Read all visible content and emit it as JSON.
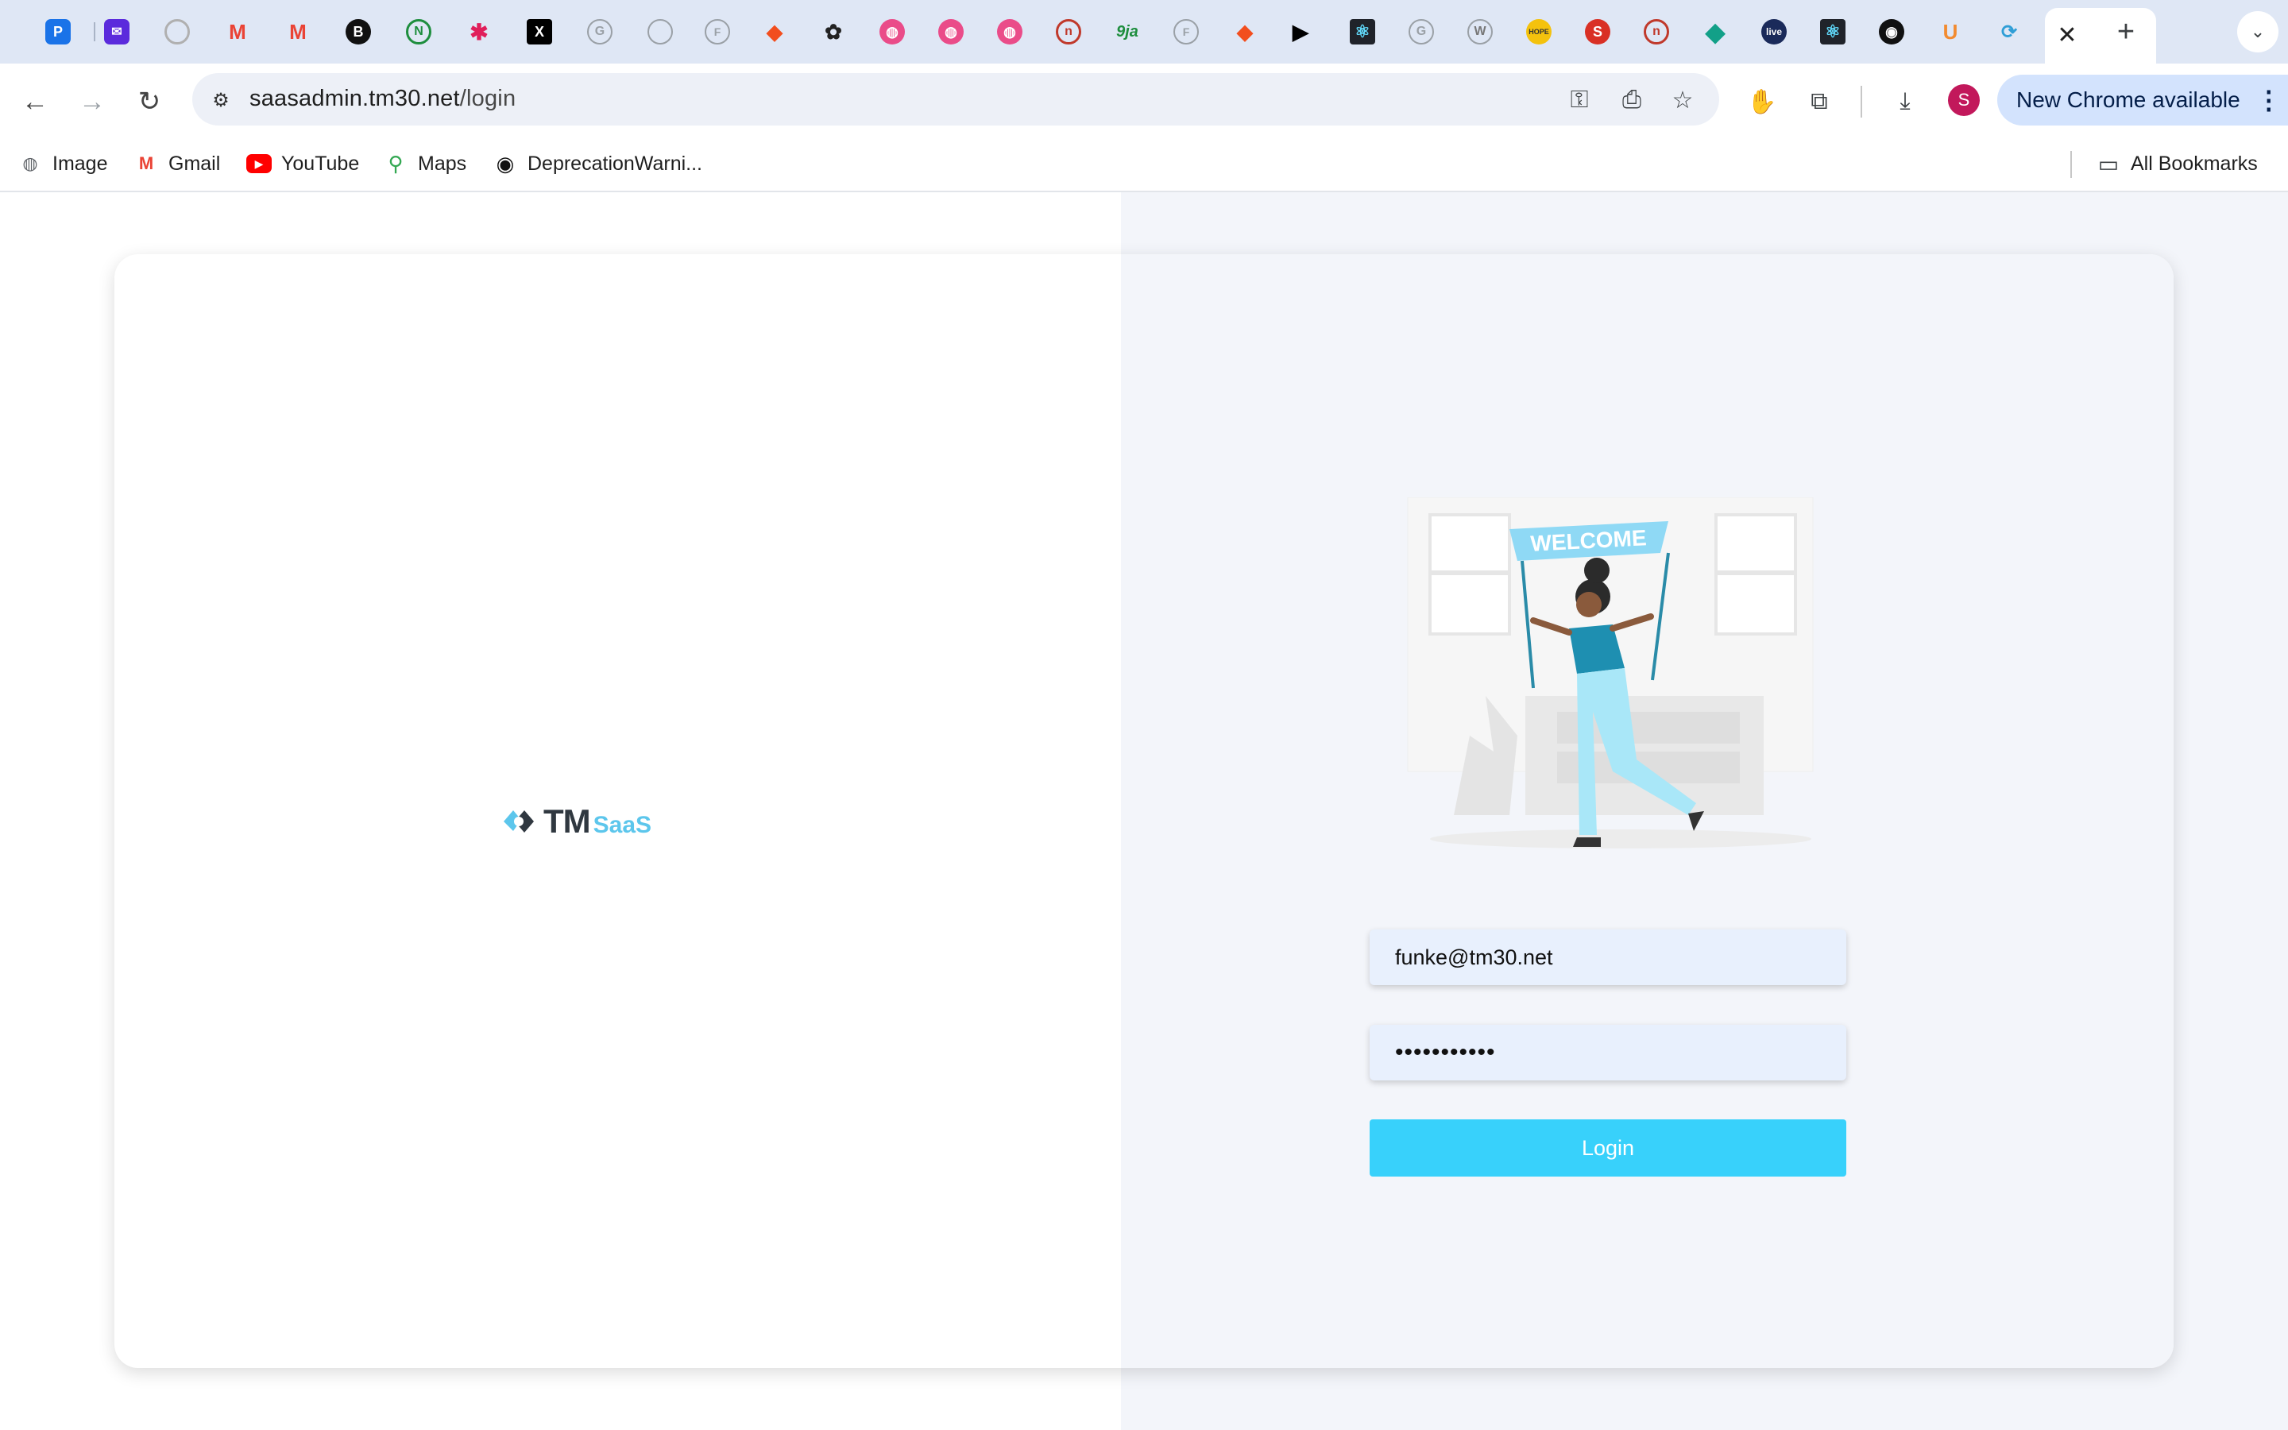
{
  "browser": {
    "tabs": [
      {
        "icon": "p-icon",
        "color": "#1a73e8"
      },
      {
        "icon": "mail-icon",
        "color": "#5b2bdc"
      },
      {
        "icon": "compass-icon",
        "color": "#b0b0b0"
      },
      {
        "icon": "gmail-icon",
        "color": "#ea4335"
      },
      {
        "icon": "gmail-icon",
        "color": "#ea4335"
      },
      {
        "icon": "b-icon",
        "color": "#111111"
      },
      {
        "icon": "green-circle-icon",
        "color": "#1e8e3e"
      },
      {
        "icon": "slack-icon",
        "color": "#e01e5a"
      },
      {
        "icon": "x-icon",
        "color": "#000000"
      },
      {
        "icon": "google-icon",
        "color": "#9aa0a6"
      },
      {
        "icon": "circle-icon",
        "color": "#9aa0a6"
      },
      {
        "icon": "figma-outline-icon",
        "color": "#9aa0a6"
      },
      {
        "icon": "figma-icon",
        "color": "#f24e1e"
      },
      {
        "icon": "openai-icon",
        "color": "#222222"
      },
      {
        "icon": "dribbble-icon",
        "color": "#ea4c89"
      },
      {
        "icon": "dribbble-icon",
        "color": "#ea4c89"
      },
      {
        "icon": "dribbble-icon",
        "color": "#ea4c89"
      },
      {
        "icon": "n-icon",
        "color": "#c0392b"
      },
      {
        "icon": "9ja-icon",
        "color": "#1e8e3e"
      },
      {
        "icon": "figma-outline-icon",
        "color": "#9aa0a6"
      },
      {
        "icon": "figma-icon",
        "color": "#f24e1e"
      },
      {
        "icon": "play-icon",
        "color": "#000000"
      },
      {
        "icon": "react-icon",
        "color": "#20232a"
      },
      {
        "icon": "google-icon",
        "color": "#9aa0a6"
      },
      {
        "icon": "wikipedia-icon",
        "color": "#9aa0a6"
      },
      {
        "icon": "hope-icon",
        "color": "#f4c20d"
      },
      {
        "icon": "s-icon",
        "color": "#d93025"
      },
      {
        "icon": "n-icon",
        "color": "#c0392b"
      },
      {
        "icon": "diamond-icon",
        "color": "#12a088"
      },
      {
        "icon": "live-icon",
        "color": "#1a2a5a"
      },
      {
        "icon": "react-icon",
        "color": "#20232a"
      },
      {
        "icon": "github-icon",
        "color": "#111111"
      },
      {
        "icon": "u-icon",
        "color": "#f28b30"
      },
      {
        "icon": "tmsaas-icon",
        "color": "#2f9ed6"
      }
    ],
    "tab_close": "✕",
    "new_tab": "+",
    "tab_search": "⌄",
    "url_host": "saasadmin.tm30.net",
    "url_path": "/login",
    "update_label": "New Chrome available",
    "avatar_letter": "S",
    "bookmarks": [
      {
        "label": "Image",
        "icon": "globe-icon"
      },
      {
        "label": "Gmail",
        "icon": "gmail-icon"
      },
      {
        "label": "YouTube",
        "icon": "youtube-icon"
      },
      {
        "label": "Maps",
        "icon": "maps-icon"
      },
      {
        "label": "DeprecationWarni...",
        "icon": "github-icon"
      }
    ],
    "all_bookmarks": "All Bookmarks"
  },
  "login": {
    "logo_tm": "TM",
    "logo_saas": "SaaS",
    "banner_text": "WELCOME",
    "email_value": "funke@tm30.net",
    "password_value": "•••••••••••",
    "login_label": "Login"
  },
  "colors": {
    "accent": "#38d1fb",
    "field_bg": "#e8f0fd",
    "right_panel_bg": "#f3f5fa"
  }
}
